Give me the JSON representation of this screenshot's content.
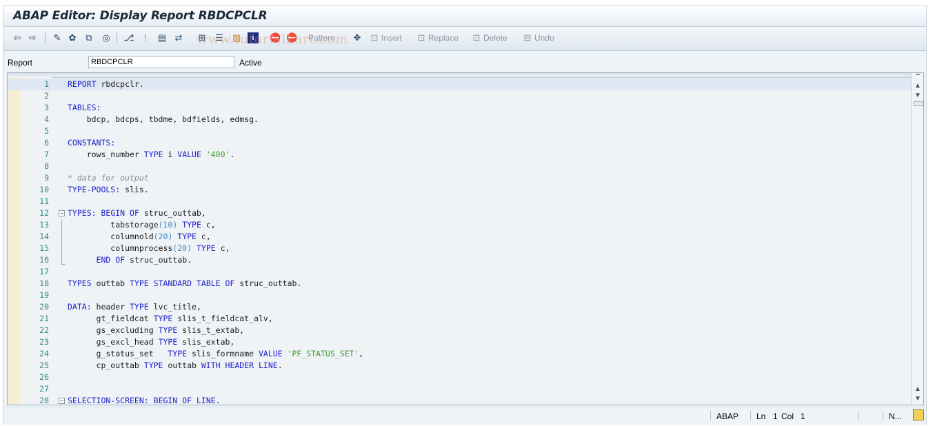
{
  "window": {
    "title": "ABAP Editor: Display Report RBDCPCLR"
  },
  "toolbar": {
    "watermark": "www.tutorialkart.com",
    "pattern_label": "Pattern",
    "insert_label": "Insert",
    "replace_label": "Replace",
    "delete_label": "Delete",
    "undo_label": "Undo"
  },
  "report_row": {
    "label": "Report",
    "value": "RBDCPCLR",
    "status": "Active"
  },
  "editor": {
    "current_line": 1,
    "lines": [
      {
        "n": "1",
        "t": "REPORT rbdcpclr."
      },
      {
        "n": "2",
        "t": ""
      },
      {
        "n": "3",
        "t": "TABLES:"
      },
      {
        "n": "4",
        "t": "    bdcp, bdcps, tbdme, bdfields, edmsg."
      },
      {
        "n": "5",
        "t": ""
      },
      {
        "n": "6",
        "t": "CONSTANTS:"
      },
      {
        "n": "7",
        "t": "    rows_number TYPE i VALUE '400'."
      },
      {
        "n": "8",
        "t": ""
      },
      {
        "n": "9",
        "t": "* data for output"
      },
      {
        "n": "10",
        "t": "TYPE-POOLS: slis."
      },
      {
        "n": "11",
        "t": ""
      },
      {
        "n": "12",
        "t": "TYPES: BEGIN OF struc_outtab,"
      },
      {
        "n": "13",
        "t": "         tabstorage(10) TYPE c,"
      },
      {
        "n": "14",
        "t": "         columnold(20) TYPE c,"
      },
      {
        "n": "15",
        "t": "         columnprocess(20) TYPE c,"
      },
      {
        "n": "16",
        "t": "      END OF struc_outtab."
      },
      {
        "n": "17",
        "t": ""
      },
      {
        "n": "18",
        "t": "TYPES outtab TYPE STANDARD TABLE OF struc_outtab."
      },
      {
        "n": "19",
        "t": ""
      },
      {
        "n": "20",
        "t": "DATA: header TYPE lvc_title,"
      },
      {
        "n": "21",
        "t": "      gt_fieldcat TYPE slis_t_fieldcat_alv,"
      },
      {
        "n": "22",
        "t": "      gs_excluding TYPE slis_t_extab,"
      },
      {
        "n": "23",
        "t": "      gs_excl_head TYPE slis_extab,"
      },
      {
        "n": "24",
        "t": "      g_status_set   TYPE slis_formname VALUE 'PF_STATUS_SET',"
      },
      {
        "n": "25",
        "t": "      cp_outtab TYPE outtab WITH HEADER LINE."
      },
      {
        "n": "26",
        "t": ""
      },
      {
        "n": "27",
        "t": ""
      },
      {
        "n": "28",
        "t": "SELECTION-SCREEN: BEGIN OF LINE."
      }
    ]
  },
  "statusbar": {
    "language": "ABAP",
    "ln_label": "Ln",
    "ln_value": "1",
    "col_label": "Col",
    "col_value": "1",
    "mode": "N..."
  }
}
